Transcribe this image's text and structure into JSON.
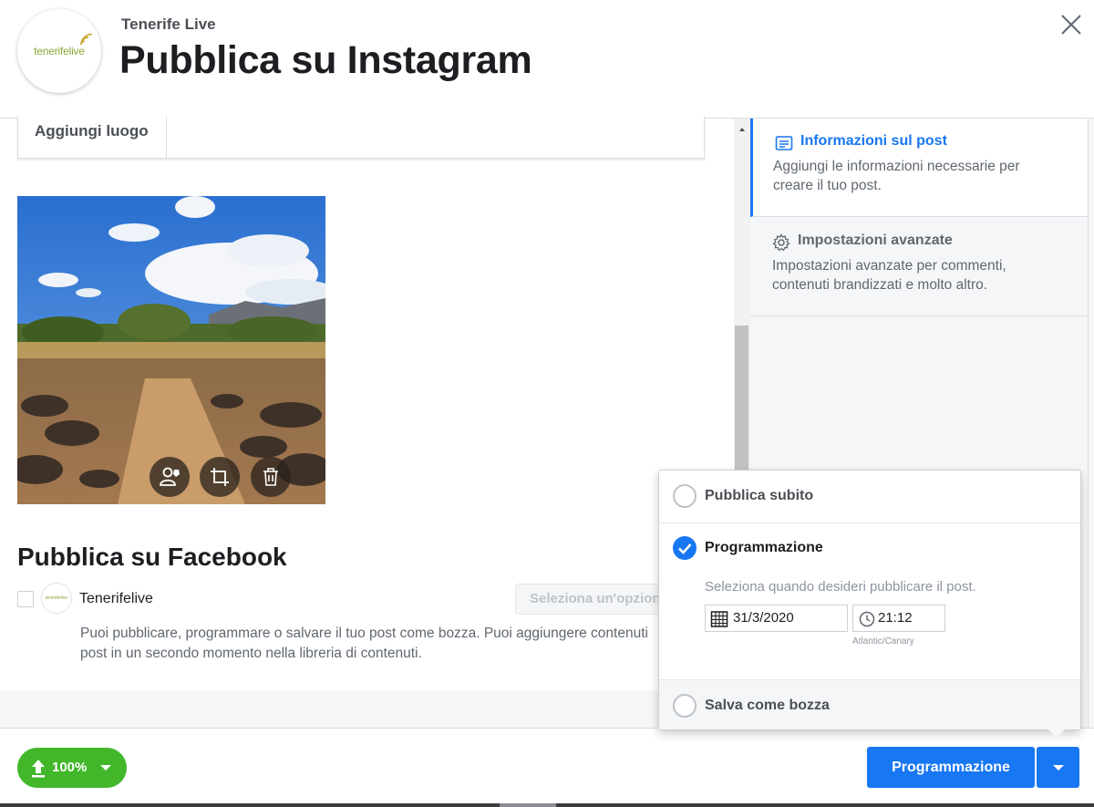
{
  "header": {
    "page_name": "Tenerife Live",
    "title": "Pubblica su Instagram",
    "logo_text": "tenerifelive",
    "close_icon": "close-icon"
  },
  "composer": {
    "location_label": "Aggiungi luogo",
    "photo_actions": [
      "tag-people-icon",
      "crop-icon",
      "trash-icon"
    ]
  },
  "facebook": {
    "title": "Pubblica su Facebook",
    "page_name": "Tenerifelive",
    "select_placeholder": "Seleziona un'opzione",
    "description_line1": "Puoi pubblicare, programmare o salvare il tuo post come bozza. Puoi aggiungere contenuti",
    "description_line2": "post in un secondo momento nella libreria di contenuti."
  },
  "sidebar": {
    "items": [
      {
        "title": "Informazioni sul post",
        "desc": "Aggiungi le informazioni necessarie per creare il tuo post.",
        "icon": "post-info-icon",
        "active": true
      },
      {
        "title": "Impostazioni avanzate",
        "desc": "Impostazioni avanzate per commenti, contenuti brandizzati e molto altro.",
        "icon": "gear-icon",
        "active": false
      }
    ]
  },
  "publish_menu": {
    "now_label": "Pubblica subito",
    "schedule_label": "Programmazione",
    "schedule_hint": "Seleziona quando desideri pubblicare il post.",
    "date": "31/3/2020",
    "time": "21:12",
    "timezone": "Atlantic/Canary",
    "draft_label": "Salva come bozza",
    "selected": "schedule"
  },
  "footer": {
    "upload_percent": "100%",
    "primary_label": "Programmazione"
  },
  "colors": {
    "brand_blue": "#1877f2",
    "upload_green": "#42b72a",
    "logo_green": "#8aa838"
  }
}
